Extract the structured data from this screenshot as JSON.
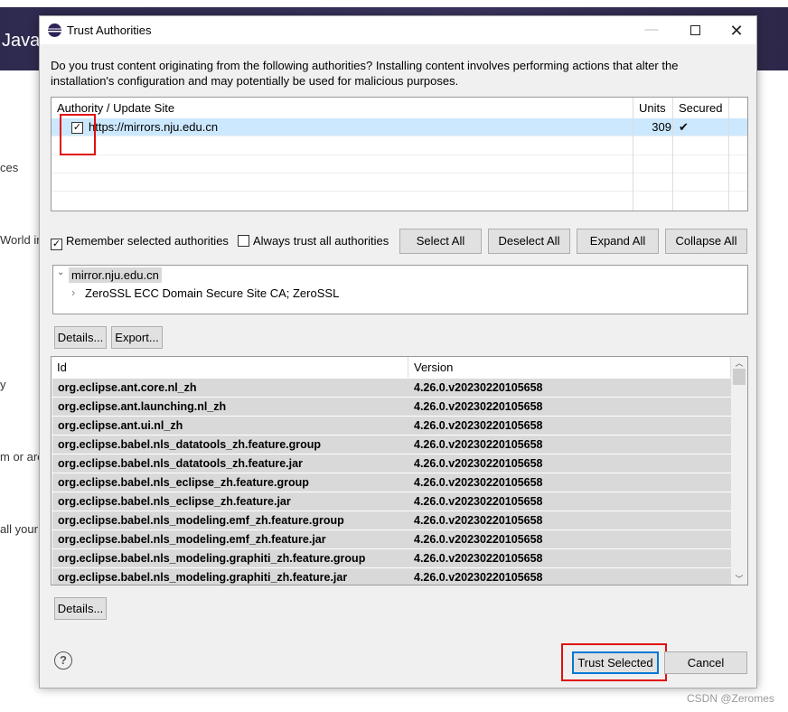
{
  "background": {
    "title": "Java",
    "fragments": [
      "ces",
      "World in",
      "y",
      "m or are",
      "all your"
    ]
  },
  "dialog": {
    "title": "Trust Authorities",
    "message_line1": "Do you trust content originating from the following authorities?  Installing content involves performing actions that alter the",
    "message_line2": "installation's configuration and may potentially be used for malicious purposes.",
    "authorities": {
      "columns": [
        "Authority / Update Site",
        "Units",
        "Secured"
      ],
      "rows": [
        {
          "site": "https://mirrors.nju.edu.cn",
          "units": "309",
          "secured": "✔",
          "checked": true
        }
      ]
    },
    "remember_label": "Remember selected authorities",
    "remember_checked": true,
    "always_trust_label": "Always trust all authorities",
    "always_trust_checked": false,
    "buttons": {
      "select_all": "Select All",
      "deselect_all": "Deselect All",
      "expand_all": "Expand All",
      "collapse_all": "Collapse All",
      "details": "Details...",
      "export": "Export...",
      "details2": "Details...",
      "trust_selected": "Trust Selected",
      "cancel": "Cancel"
    },
    "cert_tree": {
      "root": "mirror.nju.edu.cn",
      "child": "ZeroSSL ECC Domain Secure Site CA; ZeroSSL"
    },
    "units": {
      "columns": [
        "Id",
        "Version"
      ],
      "rows": [
        {
          "id": "org.eclipse.ant.core.nl_zh",
          "version": "4.26.0.v20230220105658"
        },
        {
          "id": "org.eclipse.ant.launching.nl_zh",
          "version": "4.26.0.v20230220105658"
        },
        {
          "id": "org.eclipse.ant.ui.nl_zh",
          "version": "4.26.0.v20230220105658"
        },
        {
          "id": "org.eclipse.babel.nls_datatools_zh.feature.group",
          "version": "4.26.0.v20230220105658"
        },
        {
          "id": "org.eclipse.babel.nls_datatools_zh.feature.jar",
          "version": "4.26.0.v20230220105658"
        },
        {
          "id": "org.eclipse.babel.nls_eclipse_zh.feature.group",
          "version": "4.26.0.v20230220105658"
        },
        {
          "id": "org.eclipse.babel.nls_eclipse_zh.feature.jar",
          "version": "4.26.0.v20230220105658"
        },
        {
          "id": "org.eclipse.babel.nls_modeling.emf_zh.feature.group",
          "version": "4.26.0.v20230220105658"
        },
        {
          "id": "org.eclipse.babel.nls_modeling.emf_zh.feature.jar",
          "version": "4.26.0.v20230220105658"
        },
        {
          "id": "org.eclipse.babel.nls_modeling.graphiti_zh.feature.group",
          "version": "4.26.0.v20230220105658"
        },
        {
          "id": "org.eclipse.babel.nls_modeling.graphiti_zh.feature.jar",
          "version": "4.26.0.v20230220105658"
        }
      ]
    }
  },
  "watermark": "CSDN @Zeromes",
  "colors": {
    "selection": "#cce8ff",
    "highlight": "#e01010",
    "accent": "#0078d7"
  }
}
